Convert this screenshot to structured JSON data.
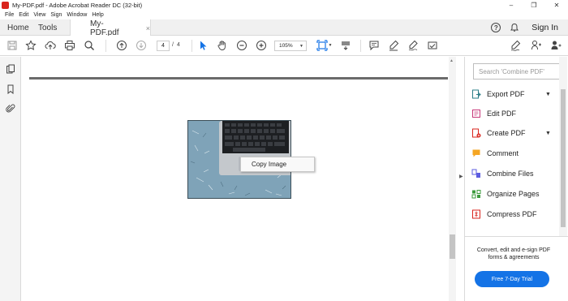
{
  "window": {
    "title": "My-PDF.pdf - Adobe Acrobat Reader DC (32-bit)",
    "controls": [
      "–",
      "❐",
      "✕"
    ]
  },
  "menubar": [
    "File",
    "Edit",
    "View",
    "Sign",
    "Window",
    "Help"
  ],
  "tabs": {
    "home": "Home",
    "tools": "Tools",
    "document": "My-PDF.pdf",
    "document_close": "×",
    "sign_in": "Sign In",
    "help_glyph": "?"
  },
  "toolbar": {
    "current_page": "4",
    "page_separator": "/",
    "total_pages": "4",
    "zoom": "105%"
  },
  "context_menu": {
    "items": [
      "Copy Image"
    ]
  },
  "right_pane": {
    "search_placeholder": "Search 'Combine PDF'",
    "tools": [
      {
        "label": "Export PDF",
        "icon": "export-pdf-icon",
        "color": "#2a7c86",
        "expandable": true
      },
      {
        "label": "Edit PDF",
        "icon": "edit-pdf-icon",
        "color": "#c8397a",
        "expandable": false
      },
      {
        "label": "Create PDF",
        "icon": "create-pdf-icon",
        "color": "#d9241c",
        "expandable": true
      },
      {
        "label": "Comment",
        "icon": "comment-icon",
        "color": "#f5a623",
        "expandable": false
      },
      {
        "label": "Combine Files",
        "icon": "combine-files-icon",
        "color": "#5c5ce0",
        "expandable": false
      },
      {
        "label": "Organize Pages",
        "icon": "organize-pages-icon",
        "color": "#3a9a3a",
        "expandable": false
      },
      {
        "label": "Compress PDF",
        "icon": "compress-pdf-icon",
        "color": "#d9241c",
        "expandable": false
      }
    ],
    "promo_text": "Convert, edit and e-sign PDF forms & agreements",
    "trial_button": "Free 7-Day Trial"
  },
  "colors": {
    "accent": "#1473e6",
    "acrobat_red": "#d9241c",
    "photo_bg": "#7fa3b8"
  }
}
